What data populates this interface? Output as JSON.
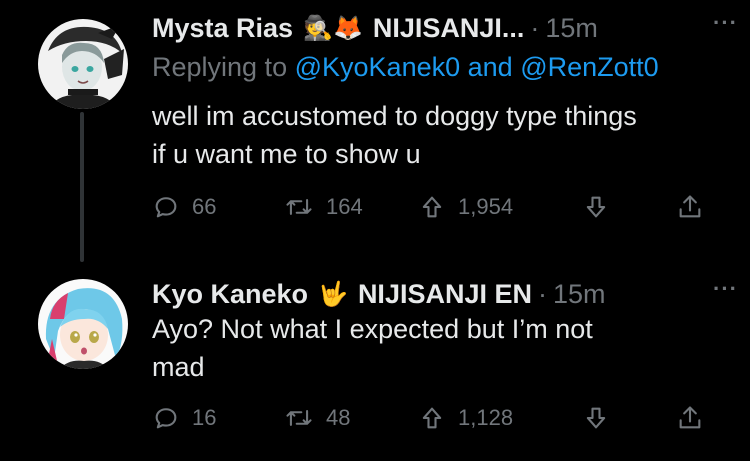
{
  "tweets": [
    {
      "author_name": "Mysta Rias",
      "author_emojis": "🕵🦊",
      "org": "NIJISANJI...",
      "separator": "·",
      "time": "15m",
      "more": "···",
      "replying_prefix": "Replying to",
      "reply_mention_1": "@KyoKanek0",
      "reply_joiner": "and",
      "reply_mention_2": "@RenZott0",
      "text_line_1": "well im accustomed to doggy type things",
      "text_line_2": "if u want me to show u",
      "replies": "66",
      "retweets": "164",
      "upvotes": "1,954"
    },
    {
      "author_name": "Kyo Kaneko",
      "author_emojis": "🤟",
      "org": "NIJISANJI EN",
      "separator": "·",
      "time": "15m",
      "more": "···",
      "text_line_1": "Ayo? Not what I expected but I’m not",
      "text_line_2": "mad",
      "replies": "16",
      "retweets": "48",
      "upvotes": "1,128"
    }
  ],
  "colors": {
    "background": "#000000",
    "text": "#e7e9ea",
    "muted": "#71767b",
    "link": "#1d9bf0",
    "thread_line": "#2f3336"
  }
}
